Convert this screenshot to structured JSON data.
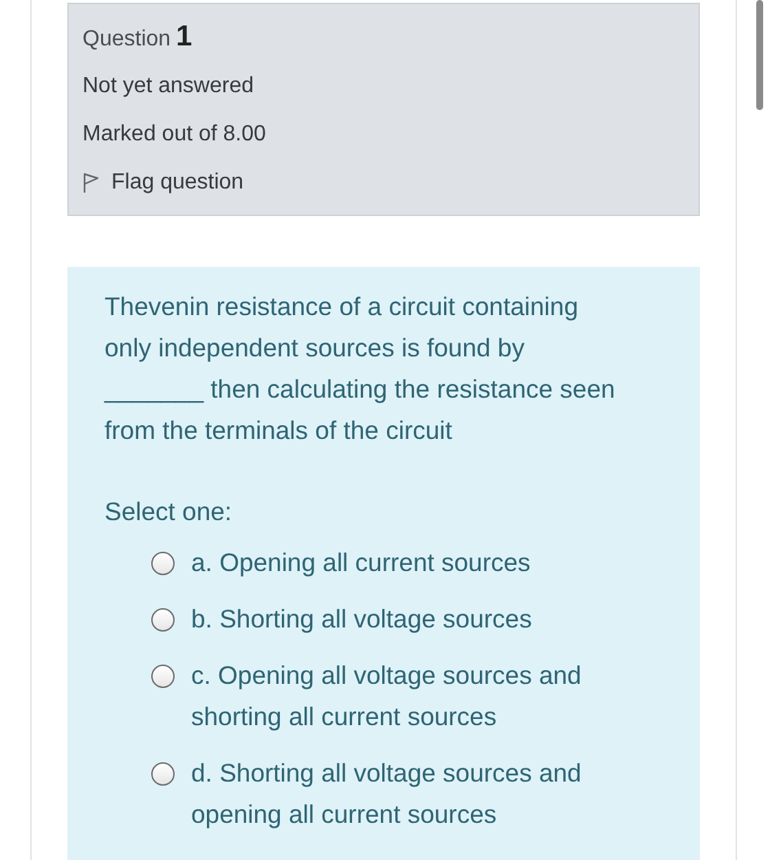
{
  "info": {
    "label": "Question",
    "number": "1",
    "status": "Not yet answered",
    "marks": "Marked out of 8.00",
    "flag": {
      "label": "Flag question",
      "flagged": false
    }
  },
  "question": {
    "text": "Thevenin resistance of a circuit containing only independent sources is found by _______ then calculating the resistance seen from the terminals of the circuit",
    "prompt": "Select one:",
    "options": [
      {
        "label": "a. Opening all current sources",
        "selected": false
      },
      {
        "label": "b. Shorting all voltage sources",
        "selected": false
      },
      {
        "label": "c. Opening all voltage sources and shorting all current sources",
        "selected": false
      },
      {
        "label": "d. Shorting all voltage sources and opening all current sources",
        "selected": false
      }
    ]
  }
}
